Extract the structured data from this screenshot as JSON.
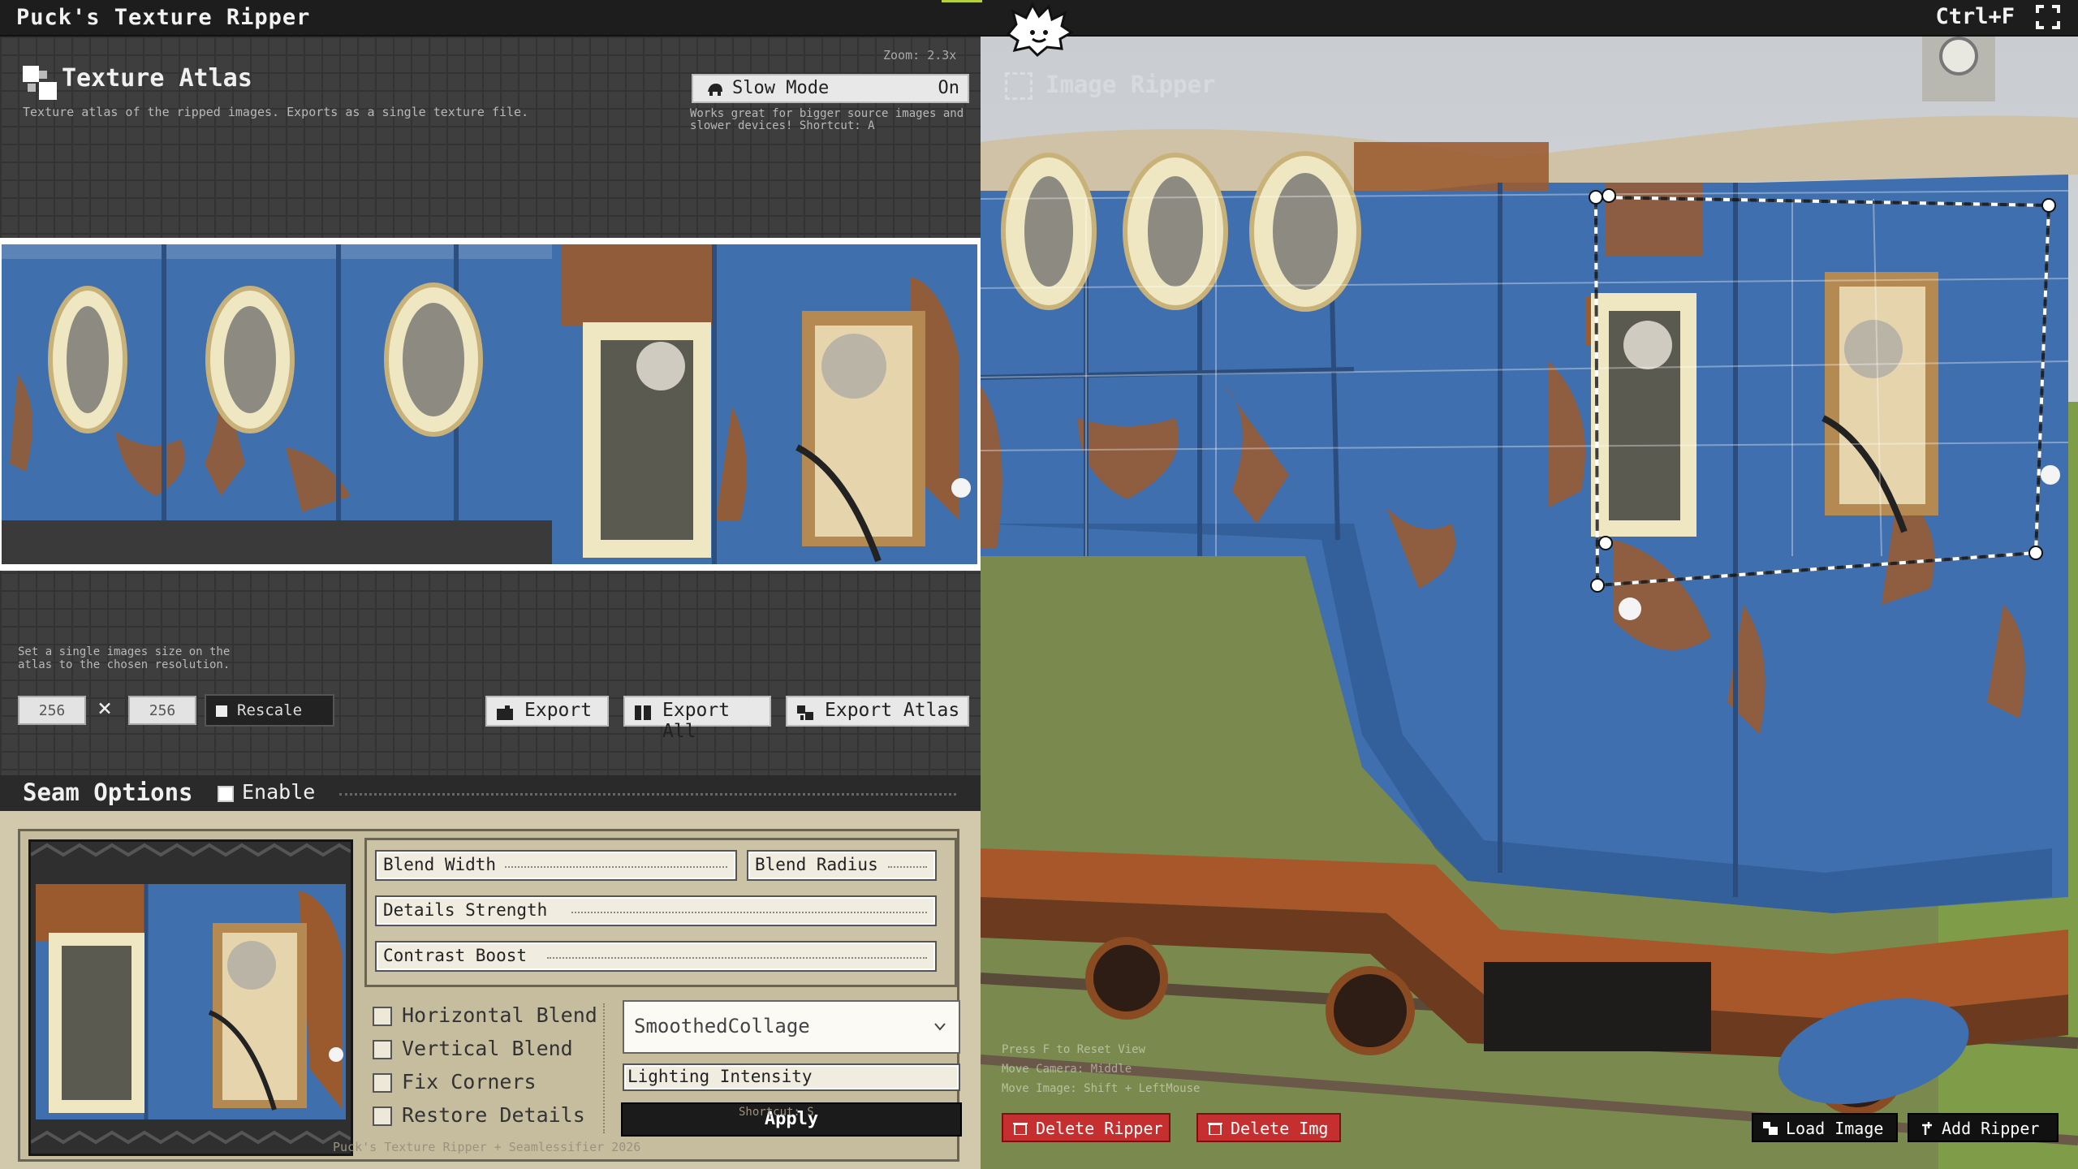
{
  "titlebar": {
    "app_title": "Puck's Texture Ripper",
    "shortcut": "Ctrl+F"
  },
  "atlas": {
    "title": "Texture Atlas",
    "description": "Texture atlas of the ripped images. Exports as a single texture file.",
    "zoom_label": "Zoom:",
    "zoom_value": "2.3x"
  },
  "slow_mode": {
    "label": "Slow Mode",
    "state": "On",
    "description": "Works great for bigger source images and slower devices! Shortcut: A"
  },
  "rescale": {
    "description": "Set a single images size on the atlas to the chosen resolution.",
    "width": "256",
    "height": "256",
    "times": "×",
    "button_label": "Rescale"
  },
  "export": {
    "export_label": "Export",
    "export_all_label": "Export All",
    "export_atlas_label": "Export Atlas"
  },
  "seam": {
    "title": "Seam Options",
    "enable_label": "Enable",
    "blend_width": "Blend Width",
    "blend_radius": "Blend Radius",
    "details_strength": "Details Strength",
    "contrast_boost": "Contrast Boost",
    "horizontal_blend": "Horizontal Blend",
    "vertical_blend": "Vertical Blend",
    "fix_corners": "Fix Corners",
    "restore_details": "Restore Details",
    "mode_selected": "SmoothedCollage",
    "lighting_intensity": "Lighting Intensity",
    "apply_label": "Apply",
    "shortcut_hint": "Shortcut: S"
  },
  "footer": {
    "credit": "Puck's Texture Ripper + Seamlessifier 2026"
  },
  "viewer": {
    "ghost_title": "Image Ripper",
    "hint_reset": "Press F to Reset View",
    "hint_camera": "Move Camera: Middle",
    "hint_image": "Move Image: Shift + LeftMouse",
    "delete_ripper_label": "Delete Ripper",
    "delete_img_label": "Delete Img",
    "load_image_label": "Load Image",
    "add_ripper_label": "Add Ripper"
  },
  "colors": {
    "accent": "#b5d13a",
    "danger": "#c62f2f",
    "panel_tan": "#d2c9ad",
    "wagon_blue": "#3f6fae",
    "rust": "#9a5a2e"
  }
}
